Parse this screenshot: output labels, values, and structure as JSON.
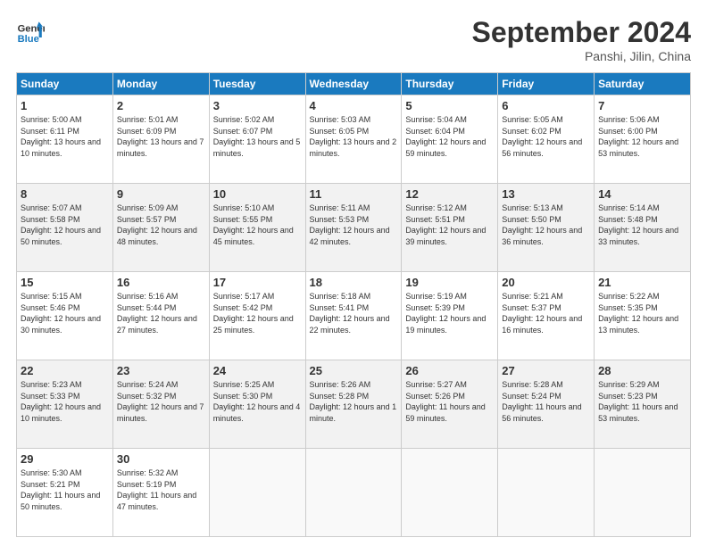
{
  "logo": {
    "line1": "General",
    "line2": "Blue"
  },
  "title": "September 2024",
  "location": "Panshi, Jilin, China",
  "weekdays": [
    "Sunday",
    "Monday",
    "Tuesday",
    "Wednesday",
    "Thursday",
    "Friday",
    "Saturday"
  ],
  "weeks": [
    [
      {
        "day": "1",
        "sunrise": "Sunrise: 5:00 AM",
        "sunset": "Sunset: 6:11 PM",
        "daylight": "Daylight: 13 hours and 10 minutes."
      },
      {
        "day": "2",
        "sunrise": "Sunrise: 5:01 AM",
        "sunset": "Sunset: 6:09 PM",
        "daylight": "Daylight: 13 hours and 7 minutes."
      },
      {
        "day": "3",
        "sunrise": "Sunrise: 5:02 AM",
        "sunset": "Sunset: 6:07 PM",
        "daylight": "Daylight: 13 hours and 5 minutes."
      },
      {
        "day": "4",
        "sunrise": "Sunrise: 5:03 AM",
        "sunset": "Sunset: 6:05 PM",
        "daylight": "Daylight: 13 hours and 2 minutes."
      },
      {
        "day": "5",
        "sunrise": "Sunrise: 5:04 AM",
        "sunset": "Sunset: 6:04 PM",
        "daylight": "Daylight: 12 hours and 59 minutes."
      },
      {
        "day": "6",
        "sunrise": "Sunrise: 5:05 AM",
        "sunset": "Sunset: 6:02 PM",
        "daylight": "Daylight: 12 hours and 56 minutes."
      },
      {
        "day": "7",
        "sunrise": "Sunrise: 5:06 AM",
        "sunset": "Sunset: 6:00 PM",
        "daylight": "Daylight: 12 hours and 53 minutes."
      }
    ],
    [
      {
        "day": "8",
        "sunrise": "Sunrise: 5:07 AM",
        "sunset": "Sunset: 5:58 PM",
        "daylight": "Daylight: 12 hours and 50 minutes."
      },
      {
        "day": "9",
        "sunrise": "Sunrise: 5:09 AM",
        "sunset": "Sunset: 5:57 PM",
        "daylight": "Daylight: 12 hours and 48 minutes."
      },
      {
        "day": "10",
        "sunrise": "Sunrise: 5:10 AM",
        "sunset": "Sunset: 5:55 PM",
        "daylight": "Daylight: 12 hours and 45 minutes."
      },
      {
        "day": "11",
        "sunrise": "Sunrise: 5:11 AM",
        "sunset": "Sunset: 5:53 PM",
        "daylight": "Daylight: 12 hours and 42 minutes."
      },
      {
        "day": "12",
        "sunrise": "Sunrise: 5:12 AM",
        "sunset": "Sunset: 5:51 PM",
        "daylight": "Daylight: 12 hours and 39 minutes."
      },
      {
        "day": "13",
        "sunrise": "Sunrise: 5:13 AM",
        "sunset": "Sunset: 5:50 PM",
        "daylight": "Daylight: 12 hours and 36 minutes."
      },
      {
        "day": "14",
        "sunrise": "Sunrise: 5:14 AM",
        "sunset": "Sunset: 5:48 PM",
        "daylight": "Daylight: 12 hours and 33 minutes."
      }
    ],
    [
      {
        "day": "15",
        "sunrise": "Sunrise: 5:15 AM",
        "sunset": "Sunset: 5:46 PM",
        "daylight": "Daylight: 12 hours and 30 minutes."
      },
      {
        "day": "16",
        "sunrise": "Sunrise: 5:16 AM",
        "sunset": "Sunset: 5:44 PM",
        "daylight": "Daylight: 12 hours and 27 minutes."
      },
      {
        "day": "17",
        "sunrise": "Sunrise: 5:17 AM",
        "sunset": "Sunset: 5:42 PM",
        "daylight": "Daylight: 12 hours and 25 minutes."
      },
      {
        "day": "18",
        "sunrise": "Sunrise: 5:18 AM",
        "sunset": "Sunset: 5:41 PM",
        "daylight": "Daylight: 12 hours and 22 minutes."
      },
      {
        "day": "19",
        "sunrise": "Sunrise: 5:19 AM",
        "sunset": "Sunset: 5:39 PM",
        "daylight": "Daylight: 12 hours and 19 minutes."
      },
      {
        "day": "20",
        "sunrise": "Sunrise: 5:21 AM",
        "sunset": "Sunset: 5:37 PM",
        "daylight": "Daylight: 12 hours and 16 minutes."
      },
      {
        "day": "21",
        "sunrise": "Sunrise: 5:22 AM",
        "sunset": "Sunset: 5:35 PM",
        "daylight": "Daylight: 12 hours and 13 minutes."
      }
    ],
    [
      {
        "day": "22",
        "sunrise": "Sunrise: 5:23 AM",
        "sunset": "Sunset: 5:33 PM",
        "daylight": "Daylight: 12 hours and 10 minutes."
      },
      {
        "day": "23",
        "sunrise": "Sunrise: 5:24 AM",
        "sunset": "Sunset: 5:32 PM",
        "daylight": "Daylight: 12 hours and 7 minutes."
      },
      {
        "day": "24",
        "sunrise": "Sunrise: 5:25 AM",
        "sunset": "Sunset: 5:30 PM",
        "daylight": "Daylight: 12 hours and 4 minutes."
      },
      {
        "day": "25",
        "sunrise": "Sunrise: 5:26 AM",
        "sunset": "Sunset: 5:28 PM",
        "daylight": "Daylight: 12 hours and 1 minute."
      },
      {
        "day": "26",
        "sunrise": "Sunrise: 5:27 AM",
        "sunset": "Sunset: 5:26 PM",
        "daylight": "Daylight: 11 hours and 59 minutes."
      },
      {
        "day": "27",
        "sunrise": "Sunrise: 5:28 AM",
        "sunset": "Sunset: 5:24 PM",
        "daylight": "Daylight: 11 hours and 56 minutes."
      },
      {
        "day": "28",
        "sunrise": "Sunrise: 5:29 AM",
        "sunset": "Sunset: 5:23 PM",
        "daylight": "Daylight: 11 hours and 53 minutes."
      }
    ],
    [
      {
        "day": "29",
        "sunrise": "Sunrise: 5:30 AM",
        "sunset": "Sunset: 5:21 PM",
        "daylight": "Daylight: 11 hours and 50 minutes."
      },
      {
        "day": "30",
        "sunrise": "Sunrise: 5:32 AM",
        "sunset": "Sunset: 5:19 PM",
        "daylight": "Daylight: 11 hours and 47 minutes."
      },
      null,
      null,
      null,
      null,
      null
    ]
  ]
}
